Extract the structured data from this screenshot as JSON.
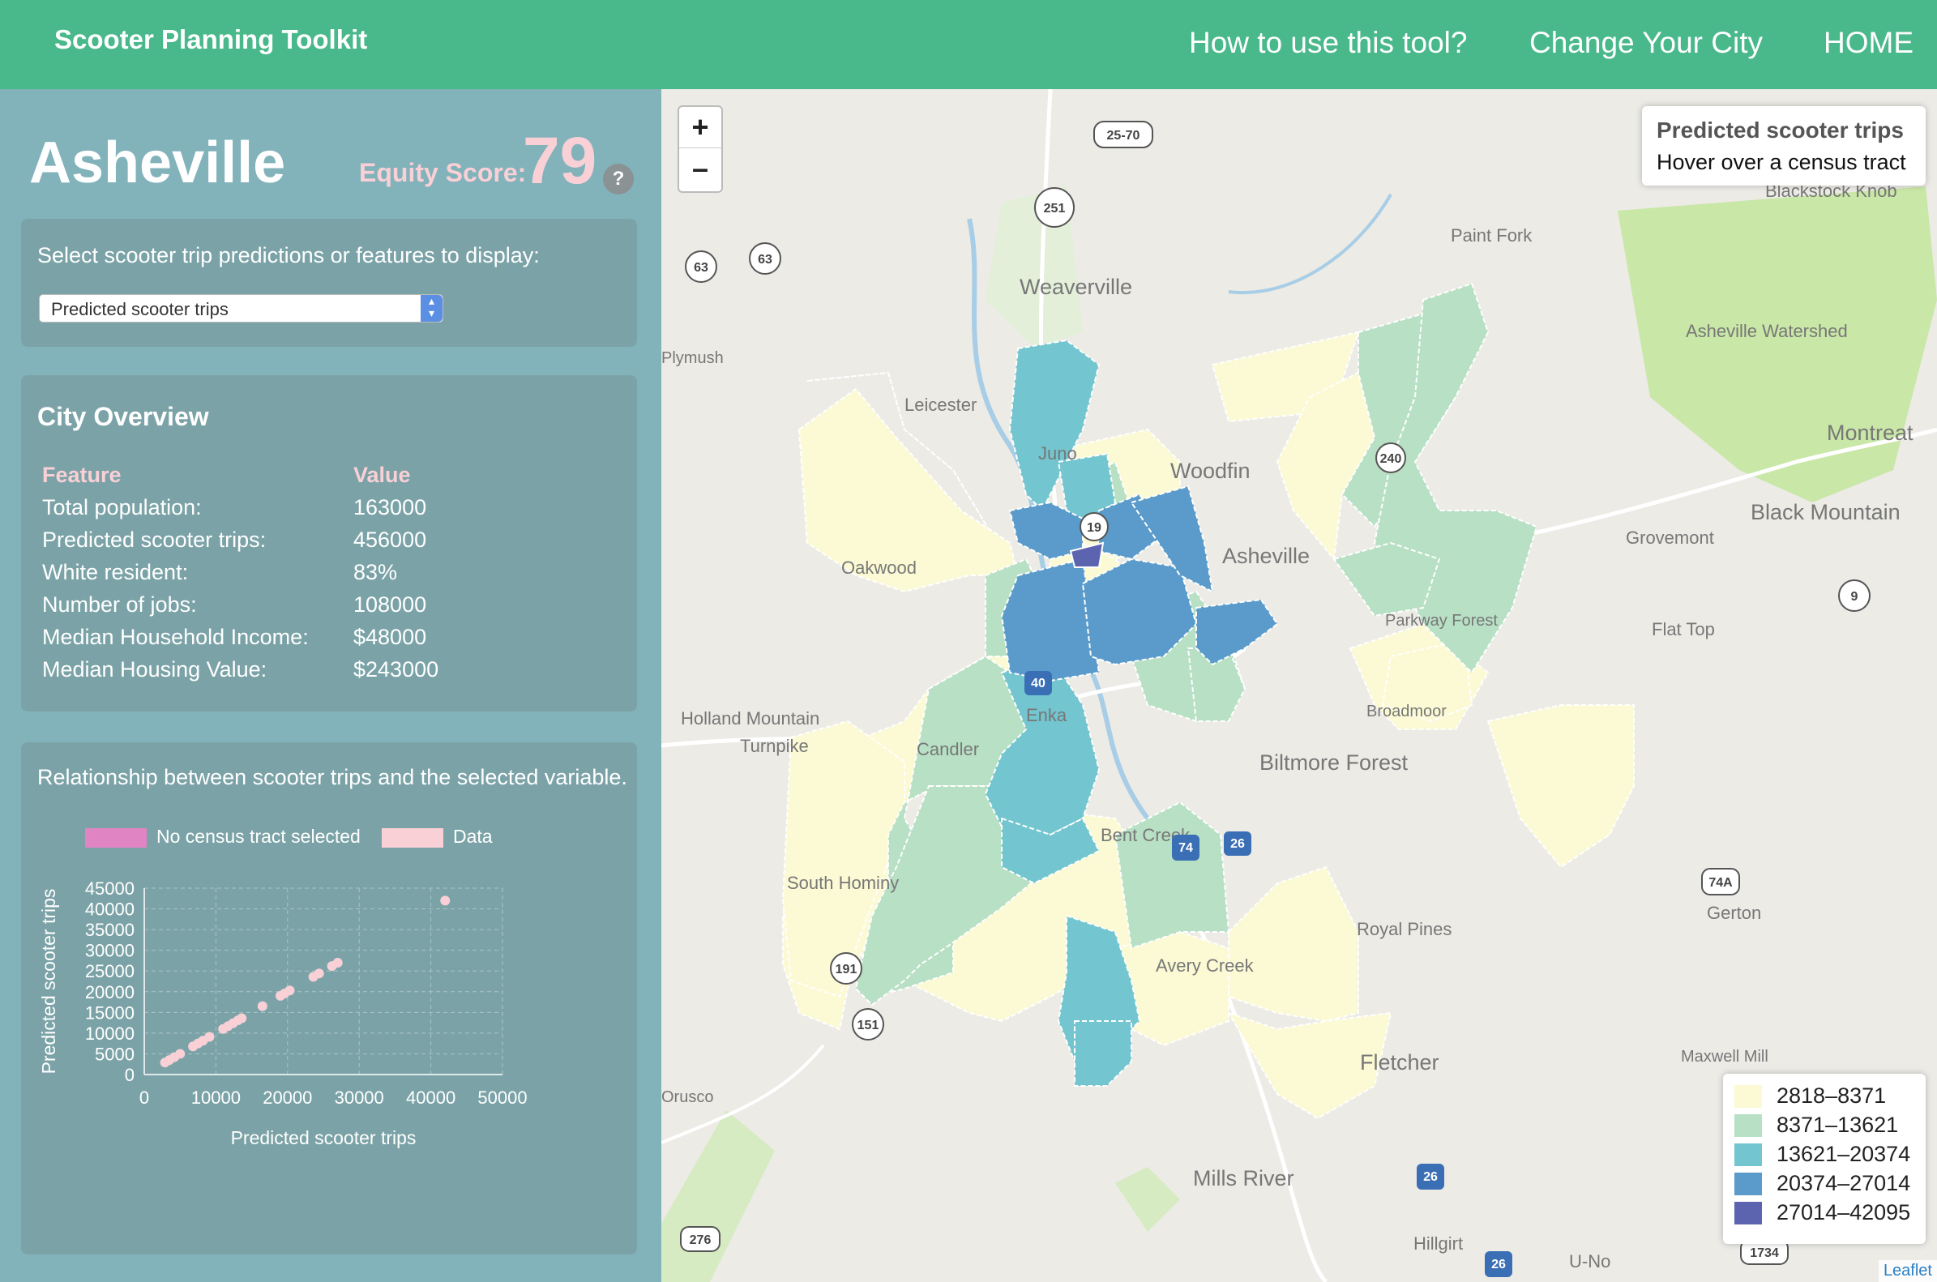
{
  "header": {
    "brand": "Scooter Planning Toolkit",
    "nav": [
      "How to use this tool?",
      "Change Your City",
      "HOME"
    ]
  },
  "sidebar": {
    "city": "Asheville",
    "equity_label": "Equity Score:",
    "equity_value": "79",
    "help_icon": "?",
    "select_prompt": "Select scooter trip predictions or features to display:",
    "select_value": "Predicted scooter trips",
    "overview": {
      "title": "City Overview",
      "header": {
        "feature": "Feature",
        "value": "Value"
      },
      "rows": [
        {
          "feature": "Total population:",
          "value": "163000"
        },
        {
          "feature": "Predicted scooter trips:",
          "value": "456000"
        },
        {
          "feature": "White resident:",
          "value": "83%"
        },
        {
          "feature": "Number of jobs:",
          "value": "108000"
        },
        {
          "feature": "Median Household Income:",
          "value": "$48000"
        },
        {
          "feature": "Median Housing Value:",
          "value": "$243000"
        }
      ]
    },
    "relationship_text": "Relationship between scooter trips and the selected variable."
  },
  "chart_data": {
    "type": "scatter",
    "legend": [
      {
        "name": "No census tract selected",
        "color": "#e084c4"
      },
      {
        "name": "Data",
        "color": "#f8d0d6"
      }
    ],
    "xlabel": "Predicted scooter trips",
    "ylabel": "Predicted scooter trips",
    "xlim": [
      0,
      50000
    ],
    "ylim": [
      0,
      45000
    ],
    "xticks": [
      0,
      10000,
      20000,
      30000,
      40000,
      50000
    ],
    "yticks": [
      0,
      5000,
      10000,
      15000,
      20000,
      25000,
      30000,
      35000,
      40000,
      45000
    ],
    "grid": true,
    "points": [
      [
        2900,
        2900
      ],
      [
        3500,
        3500
      ],
      [
        4200,
        4200
      ],
      [
        5000,
        5000
      ],
      [
        6800,
        6800
      ],
      [
        7500,
        7500
      ],
      [
        8200,
        8200
      ],
      [
        9100,
        9100
      ],
      [
        11000,
        11000
      ],
      [
        11700,
        11700
      ],
      [
        12400,
        12400
      ],
      [
        13100,
        13100
      ],
      [
        13600,
        13600
      ],
      [
        16500,
        16500
      ],
      [
        19000,
        19000
      ],
      [
        19600,
        19600
      ],
      [
        20300,
        20300
      ],
      [
        23600,
        23600
      ],
      [
        24400,
        24400
      ],
      [
        26200,
        26200
      ],
      [
        27000,
        27000
      ],
      [
        42000,
        42000
      ]
    ]
  },
  "map": {
    "info_title": "Predicted scooter trips",
    "info_hint": "Hover over a census tract",
    "legend": [
      {
        "label": "2818–8371",
        "color": "#fbfad4"
      },
      {
        "label": "8371–13621",
        "color": "#b8e0c4"
      },
      {
        "label": "13621–20374",
        "color": "#73c5cf"
      },
      {
        "label": "20374–27014",
        "color": "#5a9bcb"
      },
      {
        "label": "27014–42095",
        "color": "#5c64b0"
      }
    ],
    "attribution": "Leaflet",
    "places": [
      "Paint Fork",
      "Weaverville",
      "Leicester",
      "Juno",
      "Woodfin",
      "Oakwood",
      "Asheville",
      "Grovemont",
      "Black Mountain",
      "Montreat",
      "Blackstock Knob",
      "Asheville Watershed",
      "Flat Top",
      "Holland Mountain",
      "Turnpike",
      "Candler",
      "Enka",
      "Biltmore Forest",
      "Bent Creek",
      "South Hominy",
      "Avery Creek",
      "Royal Pines",
      "Fletcher",
      "Mills River",
      "Gerton",
      "Maxwell Mill",
      "Hillgirt",
      "U-No",
      "Broadmoor",
      "Parkway Forest",
      "Plymush",
      "Orusco"
    ],
    "shields": [
      "25-70",
      "251",
      "63",
      "63",
      "19",
      "240",
      "74A",
      "9",
      "40",
      "26",
      "191",
      "151",
      "26",
      "276",
      "1734",
      "26",
      "74"
    ]
  }
}
